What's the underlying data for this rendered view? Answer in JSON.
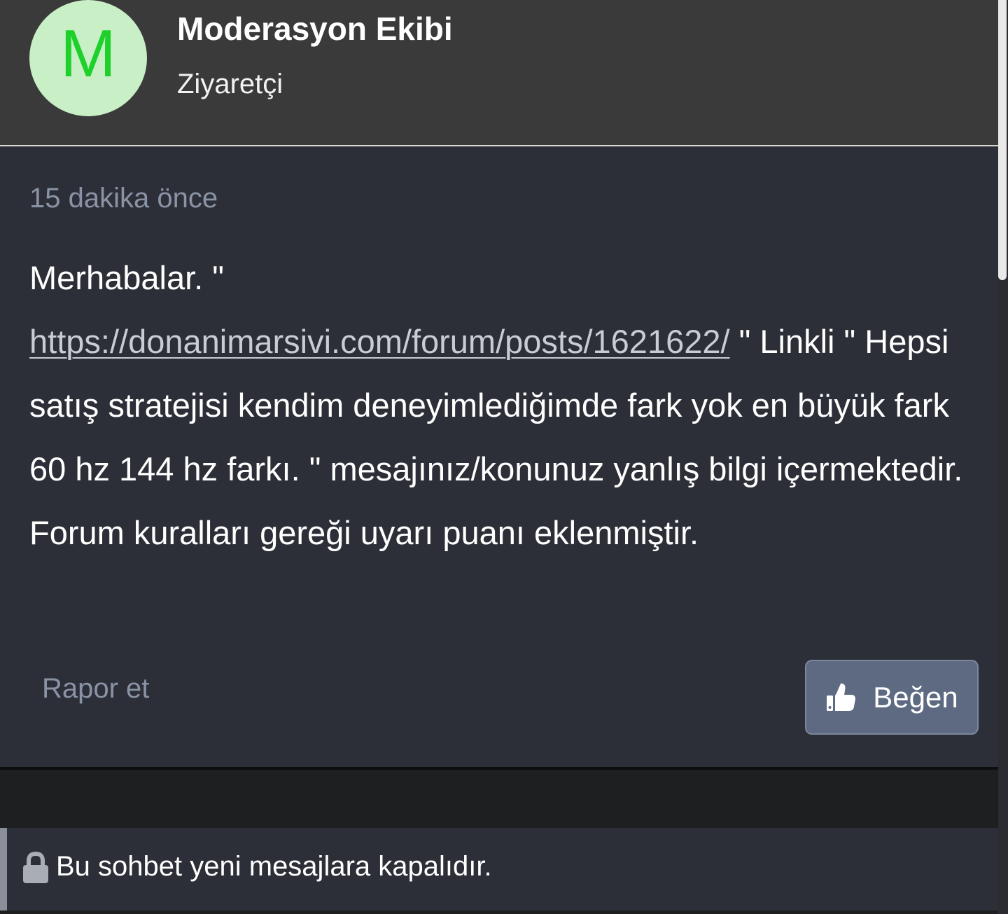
{
  "header": {
    "avatar_letter": "M",
    "author_name": "Moderasyon Ekibi",
    "author_role": "Ziyaretçi"
  },
  "post": {
    "timestamp": "15 dakika önce",
    "message_intro": "Merhabalar. \"",
    "message_link": "https://donanimarsivi.com/forum/posts/1621622/",
    "message_after_link": " \" Linkli \" Hepsi satış stratejisi kendim deneyimlediğimde fark yok en büyük fark 60 hz 144 hz farkı. \" mesajınız/konunuz yanlış bilgi içermektedir. Forum kuralları gereği uyarı puanı eklenmiştir.",
    "report_label": "Rapor et",
    "like_label": "Beğen",
    "like_icon": "thumbs-up-icon"
  },
  "notice": {
    "icon": "lock-icon",
    "text": "Bu sohbet yeni mesajlara kapalıdır."
  },
  "colors": {
    "header_bg": "#3a3a3a",
    "post_bg": "#2c2f37",
    "avatar_bg": "#c9efc6",
    "avatar_letter": "#1ed12a",
    "muted_text": "#8a93a6",
    "like_button_bg": "#5d6a81"
  }
}
